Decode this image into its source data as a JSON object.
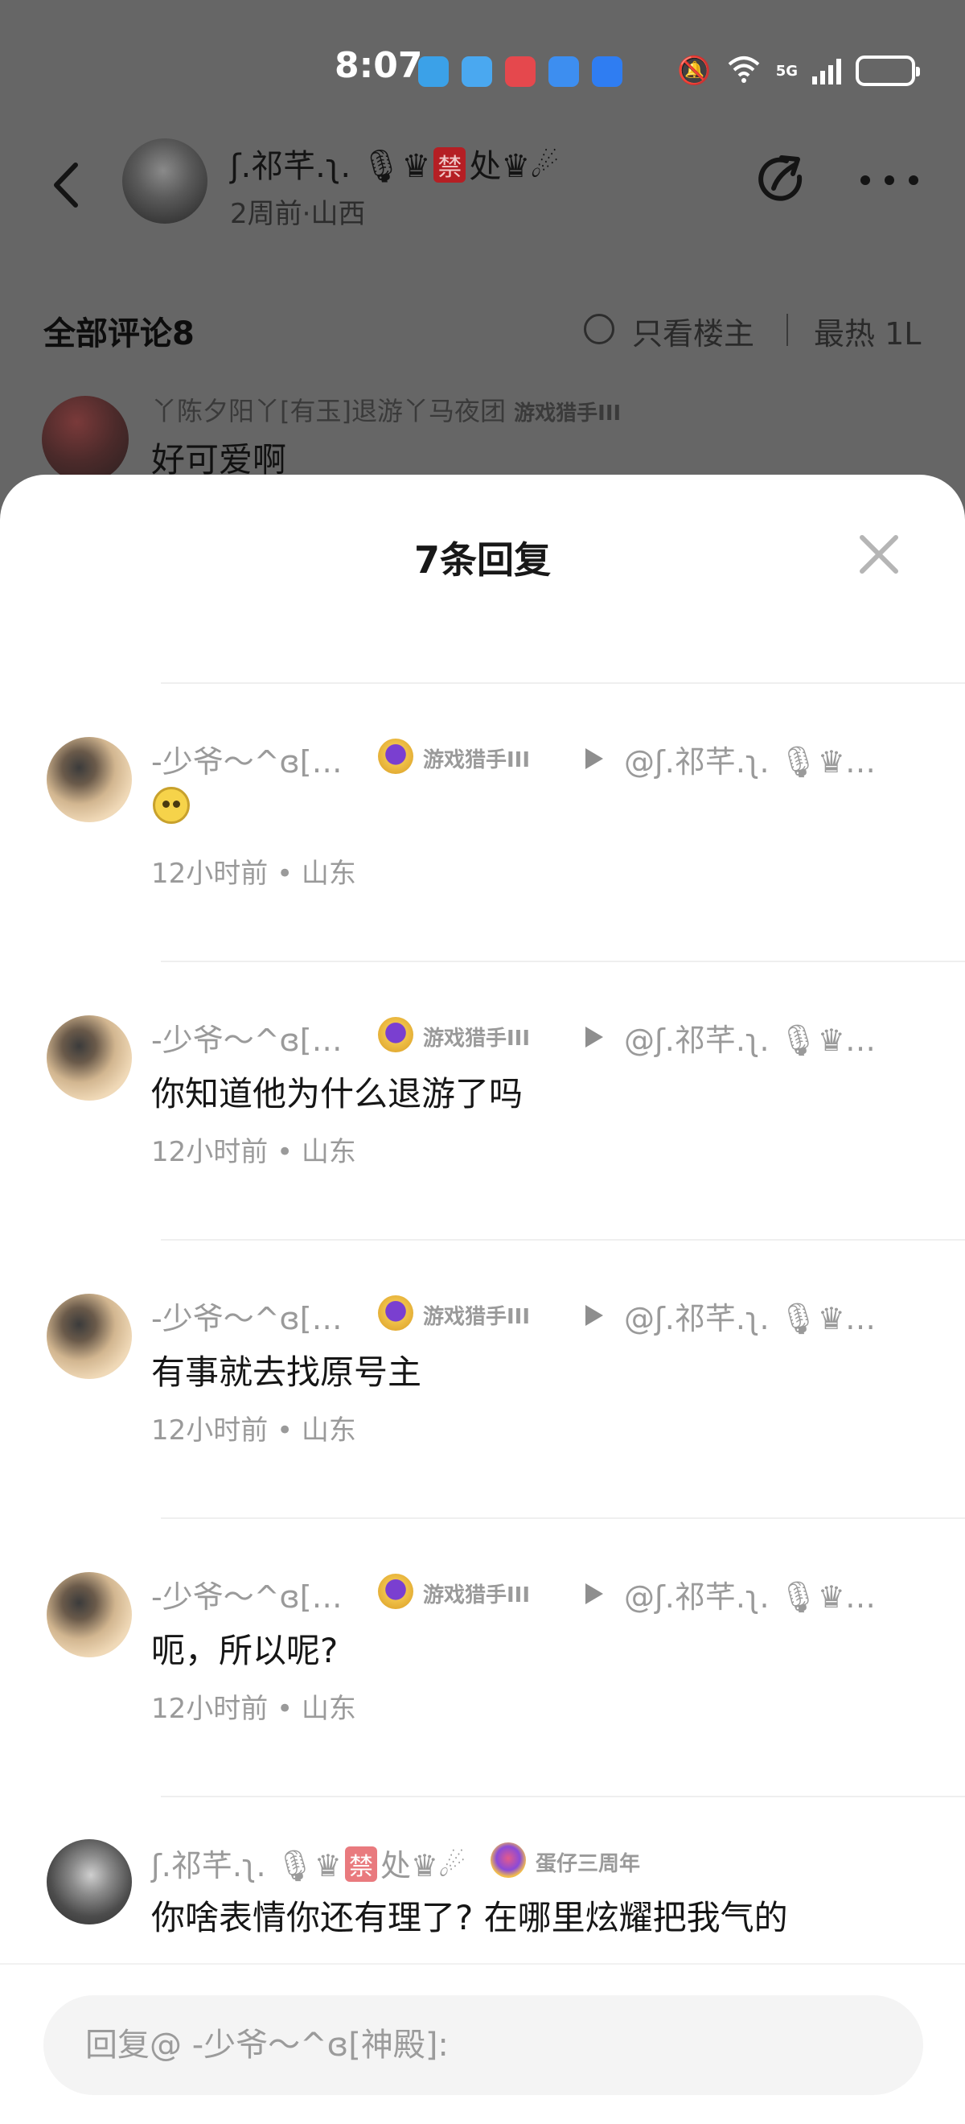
{
  "status_bar": {
    "time": "8:07",
    "app_icons": [
      {
        "name": "app-icon-blue",
        "color": "#3ba1e8"
      },
      {
        "name": "weather-icon",
        "color": "#4aa8f0"
      },
      {
        "name": "notes-icon",
        "color": "#e5484d"
      },
      {
        "name": "browser-icon",
        "color": "#3d8ef0"
      },
      {
        "name": "tips-icon",
        "color": "#2f7df2"
      }
    ],
    "network": "5G"
  },
  "post_header": {
    "author_name_prefix": "ʃ.祁芊.ʅ. 🎙♛",
    "author_badge": "禁",
    "author_name_suffix": "处♛☄",
    "meta": "2周前·山西"
  },
  "comments_bar": {
    "title": "全部评论8",
    "only_op": "只看楼主",
    "sort": "最热  1L"
  },
  "background_comment": {
    "name": "丫陈夕阳丫[有玉]退游丫马夜团",
    "medal": "游戏猎手III",
    "text": "好可爱啊"
  },
  "sheet": {
    "title": "7条回复",
    "replies": [
      {
        "name": "-少爷～^ɞ[神殿]",
        "medal": "游戏猎手III",
        "target": "@ʃ.祁芊.ʅ. 🎙♛禁处♛☄",
        "text": "",
        "emoji": "crying-laughing-emoji",
        "time": "12小时前 • 山东"
      },
      {
        "name": "-少爷～^ɞ[神殿]",
        "medal": "游戏猎手III",
        "target": "@ʃ.祁芊.ʅ. 🎙♛禁处♛☄",
        "text": "你知道他为什么退游了吗",
        "time": "12小时前 • 山东"
      },
      {
        "name": "-少爷～^ɞ[神殿]",
        "medal": "游戏猎手III",
        "target": "@ʃ.祁芊.ʅ. 🎙♛禁处♛☄",
        "text": "有事就去找原号主",
        "time": "12小时前 • 山东"
      },
      {
        "name": "-少爷～^ɞ[神殿]",
        "medal": "游戏猎手III",
        "target": "@ʃ.祁芊.ʅ. 🎙♛禁处♛☄",
        "text": "呃，所以呢?",
        "time": "12小时前 • 山东"
      }
    ],
    "op_reply": {
      "name_prefix": "ʃ.祁芊.ʅ. 🎙♛",
      "badge": "禁",
      "name_suffix": "处♛☄",
      "medal": "蛋仔三周年",
      "text": "你啥表情你还有理了? 在哪里炫耀把我气的"
    }
  },
  "reply_input": {
    "placeholder": "回复@ -少爷～^ɞ[神殿]:",
    "value": ""
  }
}
